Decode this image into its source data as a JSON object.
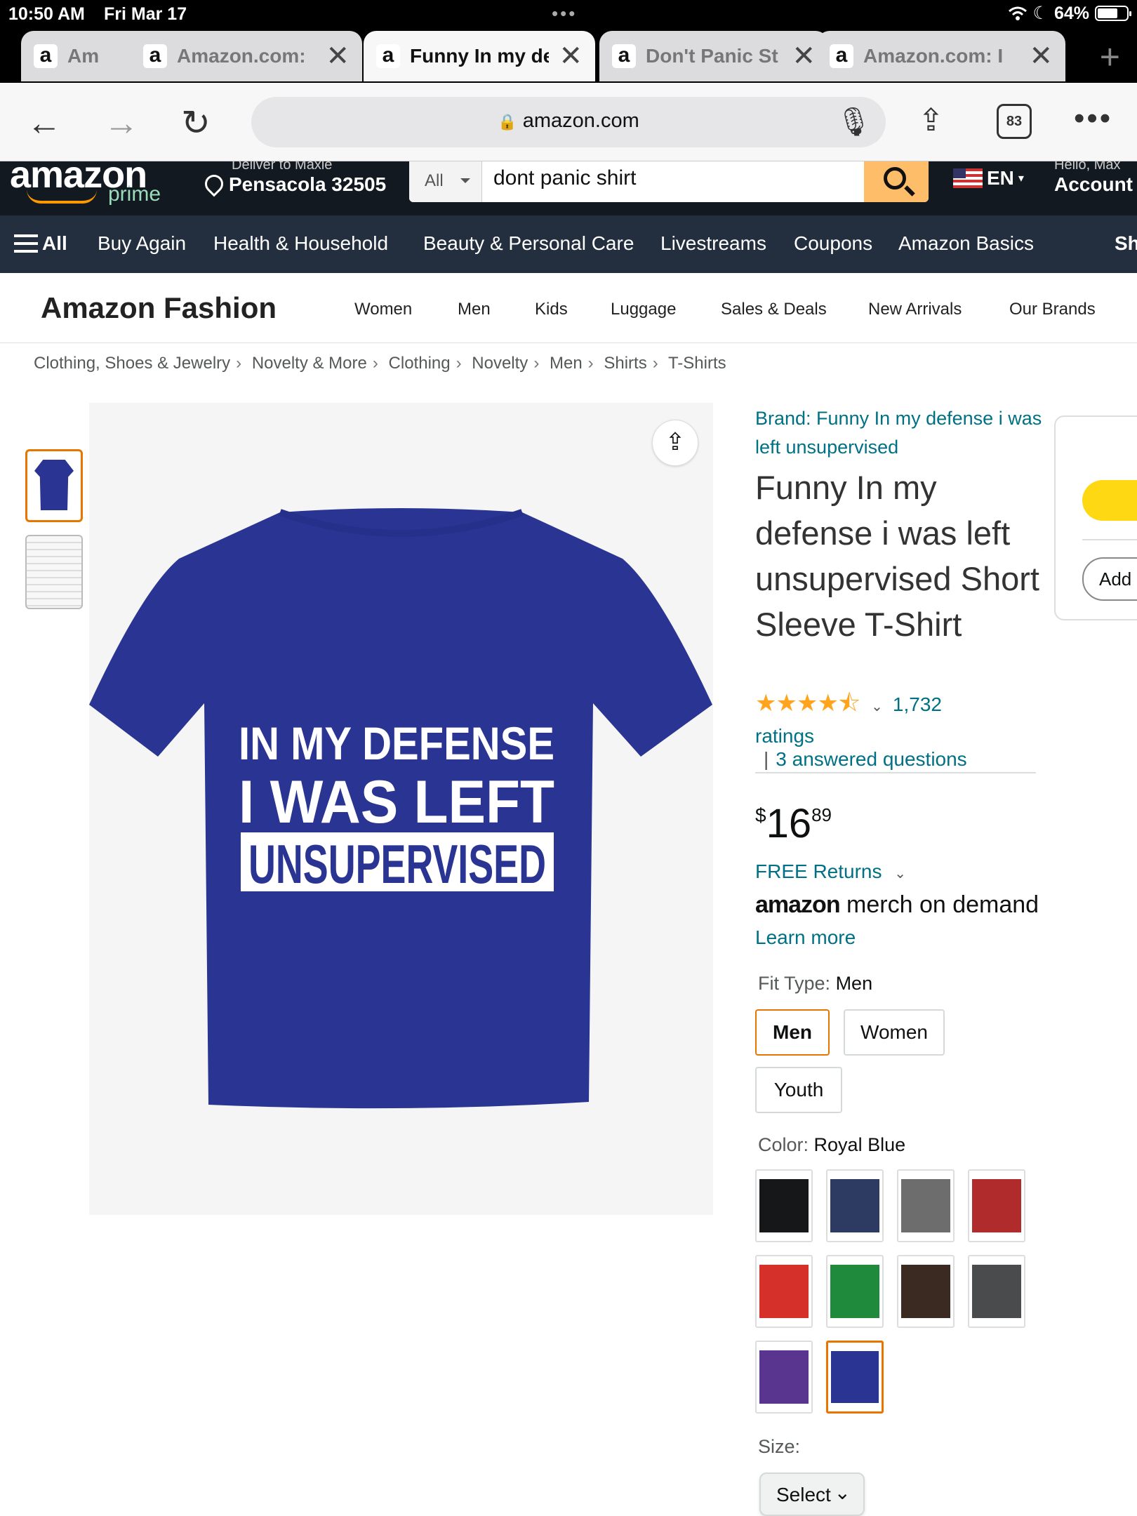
{
  "status_bar": {
    "time": "10:50 AM",
    "date": "Fri Mar 17",
    "battery": "64%",
    "icons": [
      "wifi-icon",
      "moon-icon",
      "battery-icon"
    ]
  },
  "tabs": [
    {
      "title": "Am",
      "active": false
    },
    {
      "title": "Amazon.com: ",
      "active": false
    },
    {
      "title": "Funny In my de",
      "active": true
    },
    {
      "title": "Don't Panic St",
      "active": false
    },
    {
      "title": "Amazon.com: I",
      "active": false
    }
  ],
  "browser": {
    "url": "amazon.com",
    "tab_count": "83"
  },
  "amazon_header": {
    "logo": "amazon",
    "prime": "prime",
    "deliver_to": "Deliver to Maxie",
    "location": "Pensacola 32505",
    "search_category": "All",
    "search_value": "dont panic shirt",
    "language": "EN",
    "greeting": "Hello, Max",
    "account": "Account &"
  },
  "nav": {
    "all": "All",
    "items": [
      "Buy Again",
      "Health & Household",
      "Beauty & Personal Care",
      "Livestreams",
      "Coupons",
      "Amazon Basics",
      "Sh"
    ]
  },
  "fashion": {
    "title": "Amazon Fashion",
    "links": [
      "Women",
      "Men",
      "Kids",
      "Luggage",
      "Sales & Deals",
      "New Arrivals",
      "Our Brands"
    ]
  },
  "breadcrumb": [
    "Clothing, Shoes & Jewelry",
    "Novelty & More",
    "Clothing",
    "Novelty",
    "Men",
    "Shirts",
    "T-Shirts"
  ],
  "product": {
    "image_text": [
      "IN MY DEFENSE",
      "I WAS LEFT",
      "UNSUPERVISED"
    ],
    "shirt_color": "#2a3593",
    "brand": "Brand: Funny In my defense i was left unsupervised",
    "title": "Funny In my defense i was left unsupervised Short Sleeve T-Shirt",
    "rating_stars": 4.5,
    "ratings_count": "1,732",
    "ratings_label": "ratings",
    "questions": "3 answered questions",
    "price_symbol": "$",
    "price_whole": "16",
    "price_fraction": "89",
    "free_returns": "FREE Returns",
    "merch_brand": "amazon",
    "merch_text": "merch on demand",
    "learn_more": "Learn more"
  },
  "fit_type": {
    "label": "Fit Type:",
    "selected": "Men",
    "options": [
      "Men",
      "Women",
      "Youth"
    ]
  },
  "color": {
    "label": "Color:",
    "selected": "Royal Blue",
    "swatches": [
      "#151719",
      "#2d3a62",
      "#6d6d6d",
      "#b02b2b",
      "#d6302a",
      "#1f8a3c",
      "#3a2a22",
      "#4a4b4d",
      "#5a3590",
      "#2a3593"
    ]
  },
  "size": {
    "label": "Size:",
    "select": "Select"
  },
  "buy_box": {
    "add_label": "Add"
  }
}
